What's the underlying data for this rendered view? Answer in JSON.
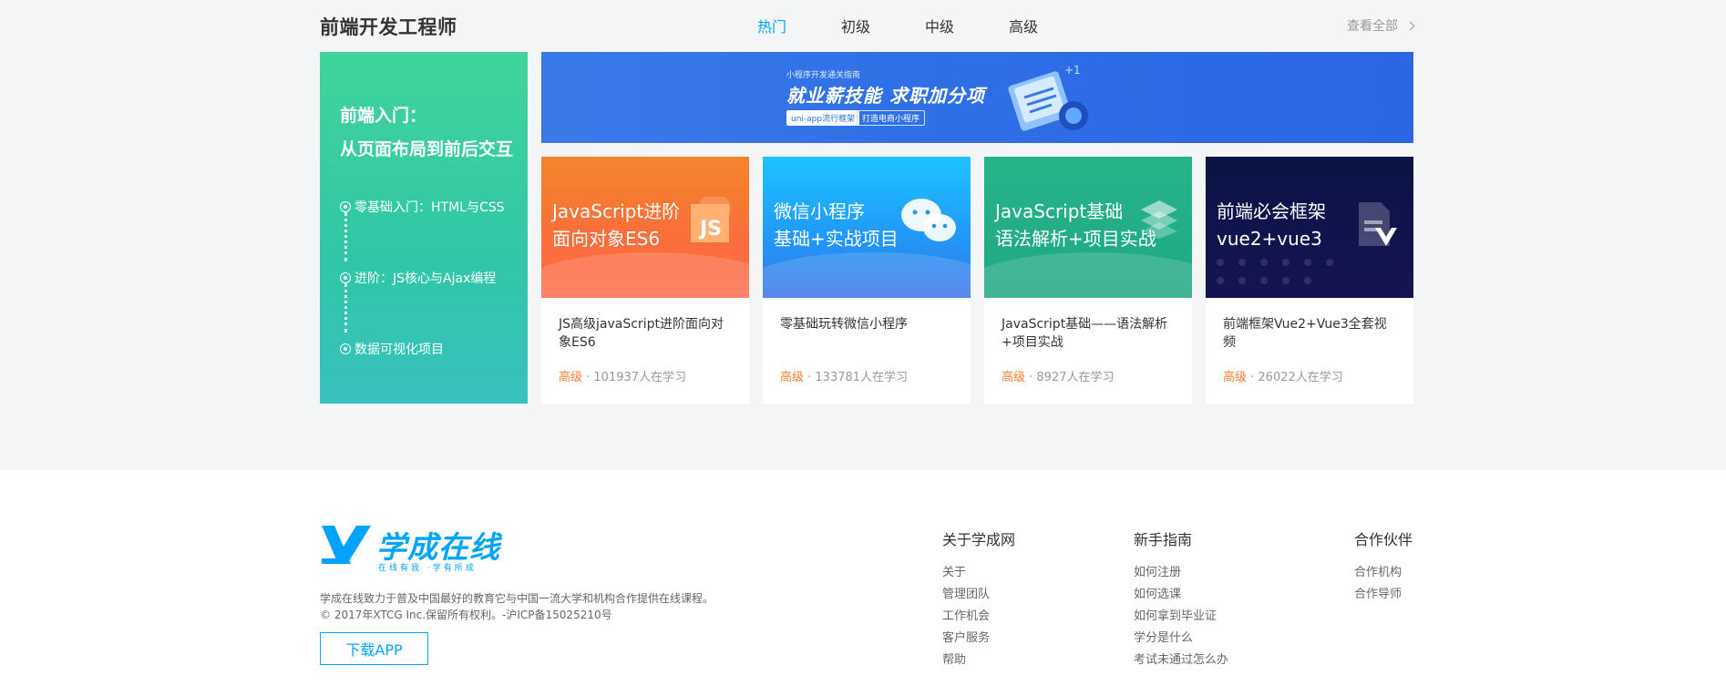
{
  "section": {
    "title": "前端开发工程师",
    "tabs": [
      "热门",
      "初级",
      "中级",
      "高级"
    ],
    "active_tab": "热门",
    "view_all": "查看全部"
  },
  "path_panel": {
    "title_line1": "前端入门：",
    "title_line2": "从页面布局到前后交互",
    "steps": [
      "零基础入门：HTML与CSS",
      "进阶：JS核心与Ajax编程",
      "数据可视化项目"
    ]
  },
  "banner": {
    "small_text": "小程序开发通关指南",
    "headline": "就业薪技能 求职加分项",
    "chip1": "uni-app流行框架",
    "chip2": "打造电商小程序"
  },
  "cards": [
    {
      "thumb_line1": "JavaScript进阶",
      "thumb_line2": "面向对象ES6",
      "icon": "js-icon",
      "name": "JS高级javaScript进阶面向对象ES6",
      "level": "高级",
      "learners": " · 101937人在学习"
    },
    {
      "thumb_line1": "微信小程序",
      "thumb_line2": "基础+实战项目",
      "icon": "wechat-icon",
      "name": "零基础玩转微信小程序",
      "level": "高级",
      "learners": " · 133781人在学习"
    },
    {
      "thumb_line1": "JavaScript基础",
      "thumb_line2": "语法解析+项目实战",
      "icon": "layers-icon",
      "name": "JavaScript基础——语法解析+项目实战",
      "level": "高级",
      "learners": " · 8927人在学习"
    },
    {
      "thumb_line1": "前端必会框架",
      "thumb_line2": "vue2+vue3",
      "icon": "vue-doc-icon",
      "name": "前端框架Vue2+Vue3全套视频",
      "level": "高级",
      "learners": " · 26022人在学习"
    }
  ],
  "footer": {
    "brand": "学成在线",
    "slogan": "在线有我 ·学有所成",
    "desc_line1": "学成在线致力于普及中国最好的教育它与中国一流大学和机构合作提供在线课程。",
    "desc_line2": "© 2017年XTCG Inc.保留所有权利。-沪ICP备15025210号",
    "download": "下载APP",
    "columns": [
      {
        "title": "关于学成网",
        "links": [
          "关于",
          "管理团队",
          "工作机会",
          "客户服务",
          "帮助"
        ]
      },
      {
        "title": "新手指南",
        "links": [
          "如何注册",
          "如何选课",
          "如何拿到毕业证",
          "学分是什么",
          "考试未通过怎么办"
        ]
      },
      {
        "title": "合作伙伴",
        "links": [
          "合作机构",
          "合作导师"
        ]
      }
    ]
  },
  "colors": {
    "accent": "#00a4ff",
    "level": "#ff7c2d",
    "panel_green": "#38c1bf"
  }
}
